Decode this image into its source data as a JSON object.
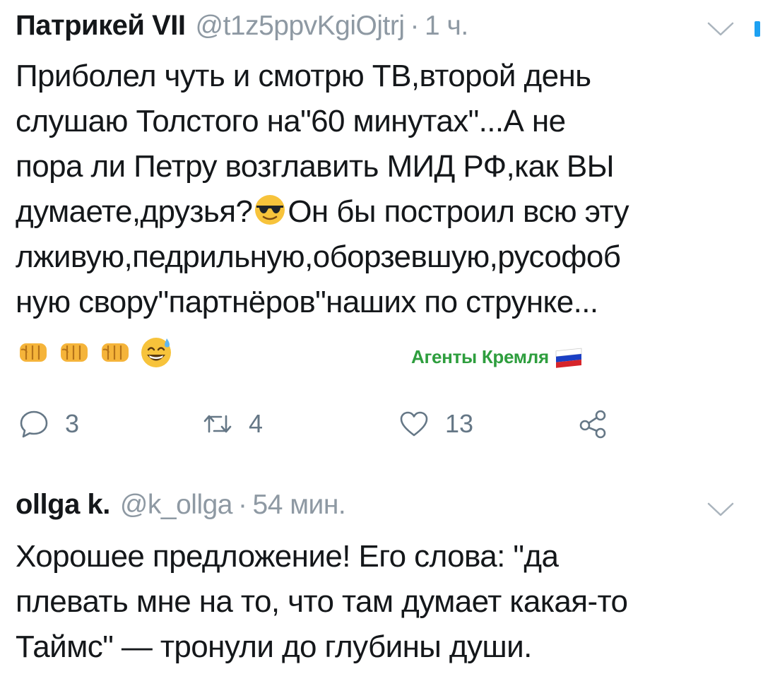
{
  "tweets": [
    {
      "display_name": "Патрикей VII",
      "handle": "@t1z5ppvKgiOjtrj",
      "separator": "·",
      "time": "1 ч.",
      "lines": [
        "Приболел чуть и смотрю ТВ,второй день",
        "слушаю Толстого на\"60 минутах\"...А не",
        "пора ли Петру возглавить МИД РФ,как ВЫ",
        "думаете,друзья?",
        "Он бы построил всю эту",
        "лживую,педрильную,оборзевшую,русофоб",
        "ную свору\"партнёров\"наших по струнке..."
      ],
      "inline_emoji": "sunglasses-emoji",
      "trailing_emojis": [
        "oncoming-fist-emoji",
        "oncoming-fist-emoji",
        "oncoming-fist-emoji",
        "grinning-sweat-emoji"
      ],
      "watermark": {
        "text": "Агенты Кремля",
        "icon": "russian-flag-icon",
        "color": "#2e9e3e"
      },
      "actions": {
        "reply_count": "3",
        "retweet_count": "4",
        "like_count": "13"
      }
    },
    {
      "display_name": "ollga k.",
      "handle": "@k_ollga",
      "separator": "·",
      "time": "54 мин.",
      "lines": [
        "Хорошее предложение! Его слова: \"да",
        "плевать мне на то, что там думает какая-то",
        "Таймс\" — тронули до глубины души."
      ]
    }
  ],
  "colors": {
    "text": "#14171a",
    "muted": "#8e99a3",
    "action": "#657786",
    "accent": "#1da1f2"
  }
}
